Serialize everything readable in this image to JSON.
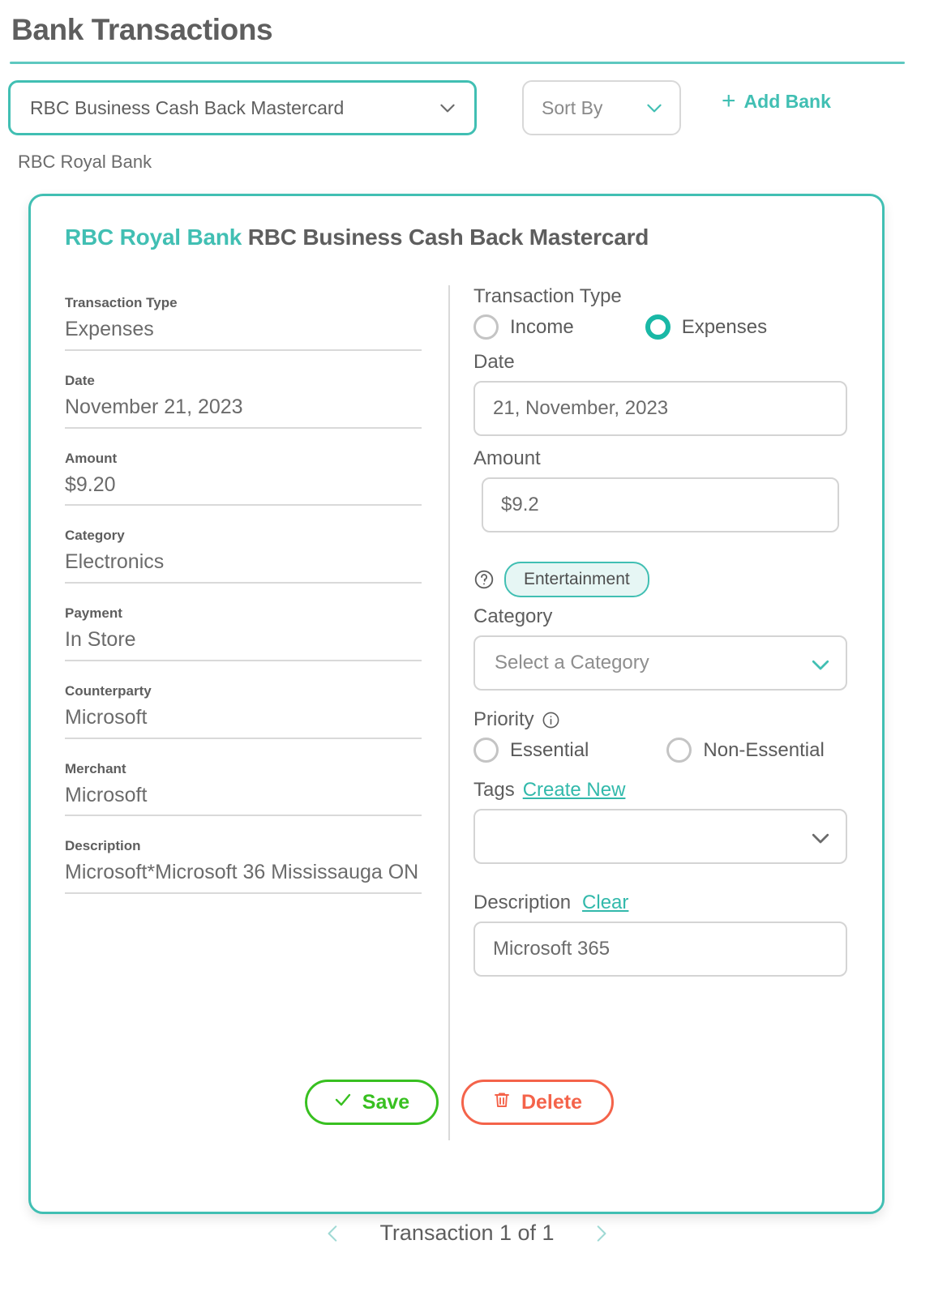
{
  "header": {
    "title": "Bank Transactions"
  },
  "toolbar": {
    "bank_select_value": "RBC Business Cash Back Mastercard",
    "sort_by_value": "Sort By",
    "add_bank_label": "Add Bank",
    "add_bank_plus": "+",
    "sub_bank_label": "RBC Royal Bank"
  },
  "card": {
    "title_accent": "RBC Royal Bank",
    "title_rest": " RBC Business Cash Back Mastercard",
    "details": [
      {
        "label": "Transaction Type",
        "value": "Expenses"
      },
      {
        "label": "Date",
        "value": "November 21, 2023"
      },
      {
        "label": "Amount",
        "value": "$9.20"
      },
      {
        "label": "Category",
        "value": "Electronics"
      },
      {
        "label": "Payment",
        "value": "In Store"
      },
      {
        "label": "Counterparty",
        "value": "Microsoft"
      },
      {
        "label": "Merchant",
        "value": "Microsoft"
      },
      {
        "label": "Description",
        "value": "Microsoft*Microsoft 36 Mississauga ON"
      }
    ],
    "form": {
      "transaction_type_label": "Transaction Type",
      "income_label": "Income",
      "expenses_label": "Expenses",
      "transaction_type_selected": "Expenses",
      "date_label": "Date",
      "date_value": "21, November, 2023",
      "amount_label": "Amount",
      "amount_value": "$9.2",
      "suggested_chip": "Entertainment",
      "category_label": "Category",
      "category_placeholder": "Select a Category",
      "category_value": "",
      "priority_label": "Priority",
      "priority_essential": "Essential",
      "priority_non_essential": "Non-Essential",
      "priority_selected": "",
      "tags_label": "Tags",
      "tags_create_new": "Create New",
      "tags_value": "",
      "description_label": "Description",
      "description_clear": "Clear",
      "description_value": "Microsoft 365"
    },
    "buttons": {
      "save_label": "Save",
      "delete_label": "Delete"
    }
  },
  "pagination": {
    "status": "Transaction 1 of 1"
  },
  "colors": {
    "accent_teal": "#41bfb3",
    "save_green": "#38c020",
    "delete_red": "#f4634a",
    "text_gray": "#5e5e5e"
  }
}
